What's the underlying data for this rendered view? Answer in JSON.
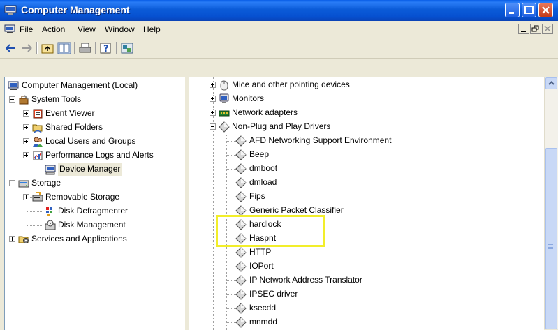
{
  "window": {
    "title": "Computer Management",
    "colors": {
      "titlebar": "#0A5FE8",
      "highlight": "#F2EE2A",
      "tree_lines": "#A0A0A0"
    }
  },
  "menu": {
    "file": "File",
    "action": "Action",
    "view": "View",
    "window": "Window",
    "help": "Help"
  },
  "toolbar": {
    "buttons": [
      "back-arrow-icon",
      "forward-arrow-icon",
      "up-folder-icon",
      "show-hide-tree-icon",
      "print-icon",
      "help-icon",
      "properties-icon"
    ]
  },
  "tree": {
    "root": "Computer Management (Local)",
    "system_tools": "System Tools",
    "event_viewer": "Event Viewer",
    "shared_folders": "Shared Folders",
    "local_users": "Local Users and Groups",
    "perf_logs": "Performance Logs and Alerts",
    "device_manager": "Device Manager",
    "storage": "Storage",
    "removable_storage": "Removable Storage",
    "disk_defrag": "Disk Defragmenter",
    "disk_management": "Disk Management",
    "services_apps": "Services and Applications"
  },
  "devices": {
    "mice": "Mice and other pointing devices",
    "monitors": "Monitors",
    "network_adapters": "Network adapters",
    "nonpnp": "Non-Plug and Play Drivers",
    "drivers": [
      "AFD Networking Support Environment",
      "Beep",
      "dmboot",
      "dmload",
      "Fips",
      "Generic Packet Classifier",
      "hardlock",
      "Haspnt",
      "HTTP",
      "IOPort",
      "IP Network Address Translator",
      "IPSEC driver",
      "ksecdd",
      "mnmdd"
    ]
  }
}
